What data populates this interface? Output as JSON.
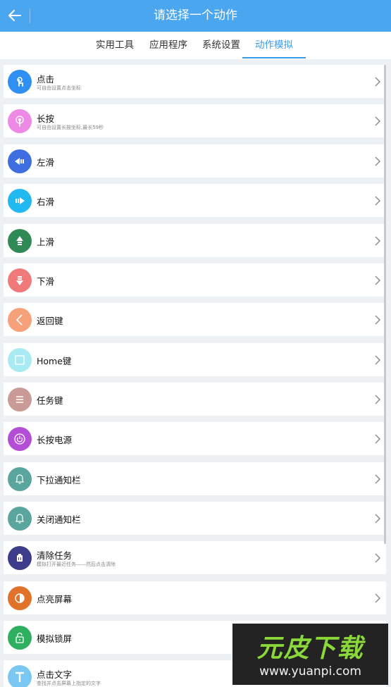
{
  "header": {
    "title": "请选择一个动作"
  },
  "tabs": [
    {
      "label": "实用工具",
      "active": false
    },
    {
      "label": "应用程序",
      "active": false
    },
    {
      "label": "系统设置",
      "active": false
    },
    {
      "label": "动作模拟",
      "active": true
    }
  ],
  "items": [
    {
      "label": "点击",
      "sub": "可自由设置点击坐标",
      "icon": "tap-icon",
      "color": "#2f8ff2"
    },
    {
      "label": "长按",
      "sub": "可自由设置长按坐标,最长59秒",
      "icon": "long-press-icon",
      "color": "#ee8ae6"
    },
    {
      "label": "左滑",
      "sub": "",
      "icon": "swipe-left-icon",
      "color": "#3f6ee0"
    },
    {
      "label": "右滑",
      "sub": "",
      "icon": "swipe-right-icon",
      "color": "#22b8f0"
    },
    {
      "label": "上滑",
      "sub": "",
      "icon": "swipe-up-icon",
      "color": "#2f8a56"
    },
    {
      "label": "下滑",
      "sub": "",
      "icon": "swipe-down-icon",
      "color": "#f07a7a"
    },
    {
      "label": "返回键",
      "sub": "",
      "icon": "back-key-icon",
      "color": "#f7a17a"
    },
    {
      "label": "Home键",
      "sub": "",
      "icon": "home-key-icon",
      "color": "#a8eaf2"
    },
    {
      "label": "任务键",
      "sub": "",
      "icon": "task-key-icon",
      "color": "#c99a96"
    },
    {
      "label": "长按电源",
      "sub": "",
      "icon": "power-icon",
      "color": "#b44ed6"
    },
    {
      "label": "下拉通知栏",
      "sub": "",
      "icon": "bell-icon",
      "color": "#5aa69e"
    },
    {
      "label": "关闭通知栏",
      "sub": "",
      "icon": "bell-off-icon",
      "color": "#5aa69e"
    },
    {
      "label": "清除任务",
      "sub": "模拟打开最近任务——然后点击清除",
      "icon": "clear-task-icon",
      "color": "#3e3d8c"
    },
    {
      "label": "点亮屏幕",
      "sub": "",
      "icon": "screen-on-icon",
      "color": "#e0722a"
    },
    {
      "label": "模拟锁屏",
      "sub": "",
      "icon": "lock-icon",
      "color": "#2fb060"
    },
    {
      "label": "点击文字",
      "sub": "查找并点击屏幕上指定的文字",
      "icon": "text-icon",
      "color": "#7ac8f2"
    }
  ],
  "watermark": {
    "main": "元皮下载",
    "url": "www.yuanpi.com"
  }
}
